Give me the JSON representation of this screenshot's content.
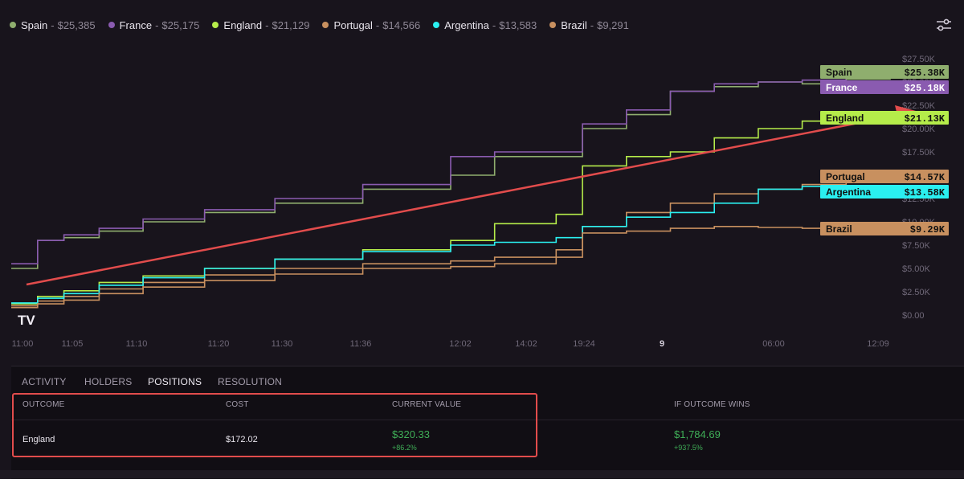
{
  "legend": [
    {
      "name": "Spain",
      "sep": "-",
      "value": "$25,385",
      "color": "#8fae6e"
    },
    {
      "name": "France",
      "sep": "-",
      "value": "$25,175",
      "color": "#8a5bb0"
    },
    {
      "name": "England",
      "sep": "-",
      "value": "$21,129",
      "color": "#b5ec4a"
    },
    {
      "name": "Portugal",
      "sep": "-",
      "value": "$14,566",
      "color": "#c8905f"
    },
    {
      "name": "Argentina",
      "sep": "-",
      "value": "$13,583",
      "color": "#2af0f0"
    },
    {
      "name": "Brazil",
      "sep": "-",
      "value": "$9,291",
      "color": "#c8905f"
    }
  ],
  "chart_data": {
    "type": "line",
    "x_ticks": [
      "11:00",
      "11:05",
      "11:10",
      "11:20",
      "11:30",
      "11:36",
      "12:02",
      "14:02",
      "19:24",
      "9",
      "06:00",
      "12:09"
    ],
    "y_ticks": [
      "$27.50K",
      "$25.00K",
      "$22.50K",
      "$20.00K",
      "$17.50K",
      "$15.00K",
      "$12.50K",
      "$10.00K",
      "$7.50K",
      "$5.00K",
      "$2.50K",
      "$0.00"
    ],
    "ylim": [
      0,
      27500
    ],
    "series": [
      {
        "name": "Spain",
        "color": "#8fae6e",
        "x": [
          0,
          3,
          6,
          10,
          15,
          22,
          30,
          40,
          50,
          55,
          65,
          70,
          75,
          80,
          85,
          90,
          95,
          100
        ],
        "y": [
          5000,
          8000,
          8300,
          9000,
          10000,
          11000,
          12000,
          13500,
          15000,
          17000,
          20000,
          21500,
          24000,
          24500,
          25000,
          24800,
          25300,
          25385
        ]
      },
      {
        "name": "France",
        "color": "#8a5bb0",
        "x": [
          0,
          3,
          6,
          10,
          15,
          22,
          30,
          40,
          50,
          55,
          65,
          70,
          75,
          80,
          85,
          90,
          95,
          100
        ],
        "y": [
          5500,
          8000,
          8600,
          9300,
          10300,
          11300,
          12500,
          14000,
          17000,
          17500,
          20500,
          22000,
          24000,
          24800,
          25000,
          25200,
          25000,
          25175
        ]
      },
      {
        "name": "England",
        "color": "#b5ec4a",
        "x": [
          0,
          3,
          6,
          10,
          15,
          22,
          30,
          40,
          50,
          55,
          62,
          65,
          70,
          75,
          80,
          85,
          90,
          95,
          100
        ],
        "y": [
          1200,
          2000,
          2600,
          3500,
          4200,
          5000,
          6000,
          7000,
          8000,
          9800,
          10800,
          16000,
          17000,
          17500,
          19000,
          20000,
          20800,
          21500,
          21129
        ]
      },
      {
        "name": "Portugal",
        "color": "#c8905f",
        "x": [
          0,
          3,
          6,
          10,
          15,
          22,
          30,
          40,
          50,
          55,
          62,
          65,
          70,
          75,
          80,
          85,
          90,
          95,
          100
        ],
        "y": [
          1000,
          1500,
          2000,
          2800,
          3500,
          4300,
          5000,
          5500,
          5800,
          6200,
          7000,
          9500,
          11000,
          12000,
          13000,
          13500,
          14000,
          14500,
          14566
        ]
      },
      {
        "name": "Argentina",
        "color": "#2af0f0",
        "x": [
          0,
          3,
          6,
          10,
          15,
          22,
          30,
          40,
          50,
          55,
          62,
          65,
          70,
          75,
          80,
          85,
          90,
          95,
          100
        ],
        "y": [
          1300,
          1800,
          2300,
          3200,
          4000,
          5000,
          6000,
          6800,
          7500,
          7800,
          8300,
          9500,
          10500,
          11000,
          12000,
          13500,
          13800,
          13600,
          13583
        ]
      },
      {
        "name": "Brazil",
        "color": "#c8905f",
        "x": [
          0,
          3,
          6,
          10,
          15,
          22,
          30,
          40,
          50,
          55,
          62,
          65,
          70,
          75,
          80,
          85,
          90,
          95,
          100
        ],
        "y": [
          800,
          1200,
          1600,
          2300,
          3000,
          3700,
          4400,
          5000,
          5200,
          5500,
          6200,
          8800,
          9000,
          9300,
          9500,
          9400,
          9300,
          9300,
          9291
        ]
      }
    ],
    "end_labels": [
      {
        "name": "Spain",
        "value": "$25.38K",
        "color": "#8fae6e",
        "text_color": "#111111"
      },
      {
        "name": "France",
        "value": "$25.18K",
        "color": "#8a5bb0",
        "text_color": "#ffffff"
      },
      {
        "name": "England",
        "value": "$21.13K",
        "color": "#b5ec4a",
        "text_color": "#111111"
      },
      {
        "name": "Portugal",
        "value": "$14.57K",
        "color": "#c8905f",
        "text_color": "#111111"
      },
      {
        "name": "Argentina",
        "value": "$13.58K",
        "color": "#2af0f0",
        "text_color": "#111111"
      },
      {
        "name": "Brazil",
        "value": "$9.29K",
        "color": "#c8905f",
        "text_color": "#111111"
      }
    ]
  },
  "tabs": [
    "ACTIVITY",
    "HOLDERS",
    "POSITIONS",
    "RESOLUTION"
  ],
  "active_tab": "POSITIONS",
  "table": {
    "headers": [
      "OUTCOME",
      "COST",
      "CURRENT VALUE",
      "IF OUTCOME WINS"
    ],
    "row": {
      "outcome": "England",
      "cost": "$172.02",
      "current_value": "$320.33",
      "current_change": "+86.2%",
      "if_wins": "$1,784.69",
      "if_wins_change": "+937.5%"
    }
  },
  "annotation_color": "#e24c4c",
  "watermark": "TV"
}
